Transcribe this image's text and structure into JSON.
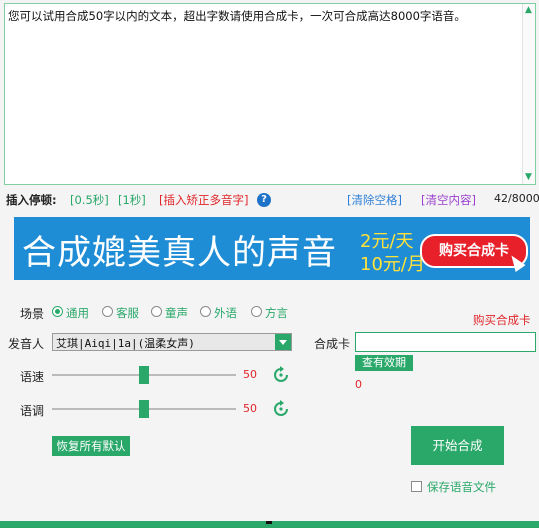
{
  "textarea": {
    "content": "您可以试用合成50字以内的文本，超出字数请使用合成卡，一次可合成高达8000字语音。"
  },
  "pause": {
    "label": "插入停顿:",
    "half_second": "[0.5秒]",
    "one_second": "[1秒]",
    "polyphone": "[插入矫正多音字]",
    "clear_spaces": "[清除空格]",
    "clear_content": "[清空内容]",
    "count": "42/8000"
  },
  "banner": {
    "headline": "合成媲美真人的声音",
    "price_day": "2元/天",
    "price_month": "10元/月",
    "buy_label": "购买合成卡"
  },
  "scene": {
    "label": "场景",
    "options": [
      "通用",
      "客服",
      "童声",
      "外语",
      "方言"
    ],
    "selected": "通用"
  },
  "buy_card_link": "购买合成卡",
  "voice": {
    "label": "发音人",
    "selected": "艾琪|Aiqi|1a|(温柔女声)"
  },
  "card": {
    "label": "合成卡",
    "value": "",
    "check_label": "查有效期",
    "remaining": "0"
  },
  "speed": {
    "label": "语速",
    "value": 50,
    "max": 100
  },
  "pitch": {
    "label": "语调",
    "value": 50,
    "max": 100
  },
  "restore_label": "恢复所有默认",
  "start_label": "开始合成",
  "save_audio": {
    "label": "保存语音文件",
    "checked": false
  },
  "colors": {
    "accent": "#2aa86a",
    "banner": "#1f8dd6",
    "alert": "#e0252a"
  }
}
